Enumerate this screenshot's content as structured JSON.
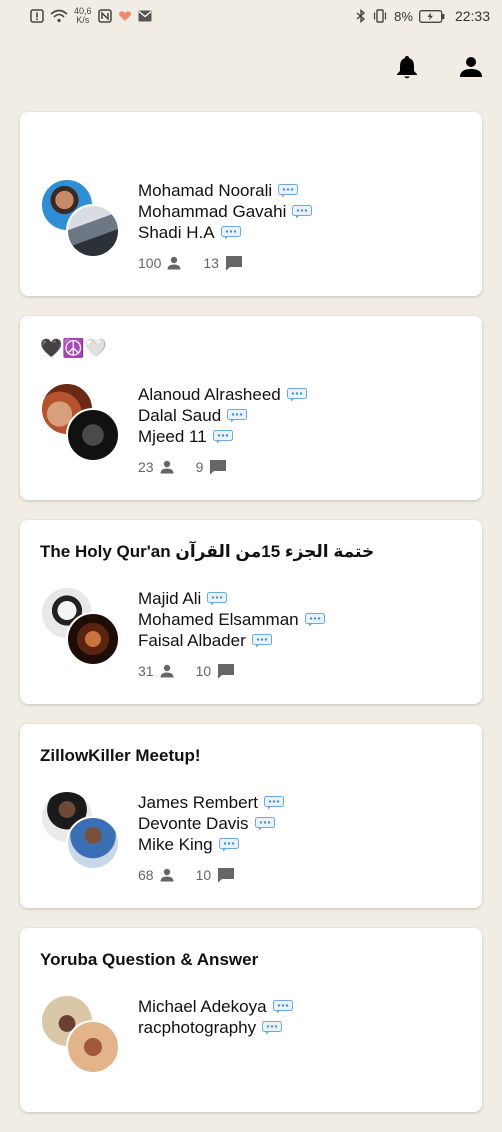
{
  "status_bar": {
    "speed_value": "40,6",
    "speed_unit": "K/s",
    "battery": "8%",
    "time": "22:33"
  },
  "cards": [
    {
      "title": "",
      "speakers": [
        "Mohamad Noorali",
        "Mohammad Gavahi",
        "Shadi H.A"
      ],
      "listeners": "100",
      "speakers_count": "13"
    },
    {
      "title": "🖤☮️🤍",
      "speakers": [
        "Alanoud Alrasheed",
        "Dalal Saud",
        "Mjeed 11"
      ],
      "listeners": "23",
      "speakers_count": "9"
    },
    {
      "title": "The Holy Qur'an ختمة الجزء 15من القرآن",
      "speakers": [
        "Majid Ali",
        "Mohamed Elsamman",
        "Faisal Albader"
      ],
      "listeners": "31",
      "speakers_count": "10"
    },
    {
      "title": "ZillowKiller Meetup!",
      "speakers": [
        "James Rembert",
        "Devonte Davis",
        "Mike King"
      ],
      "listeners": "68",
      "speakers_count": "10"
    },
    {
      "title": "Yoruba Question & Answer",
      "speakers": [
        "Michael Adekoya",
        "racphotography"
      ],
      "listeners": "",
      "speakers_count": ""
    }
  ],
  "colors": {
    "background": "#f1ede4",
    "card": "#ffffff",
    "bubble": "#6aa8e6",
    "muted": "#666666"
  }
}
